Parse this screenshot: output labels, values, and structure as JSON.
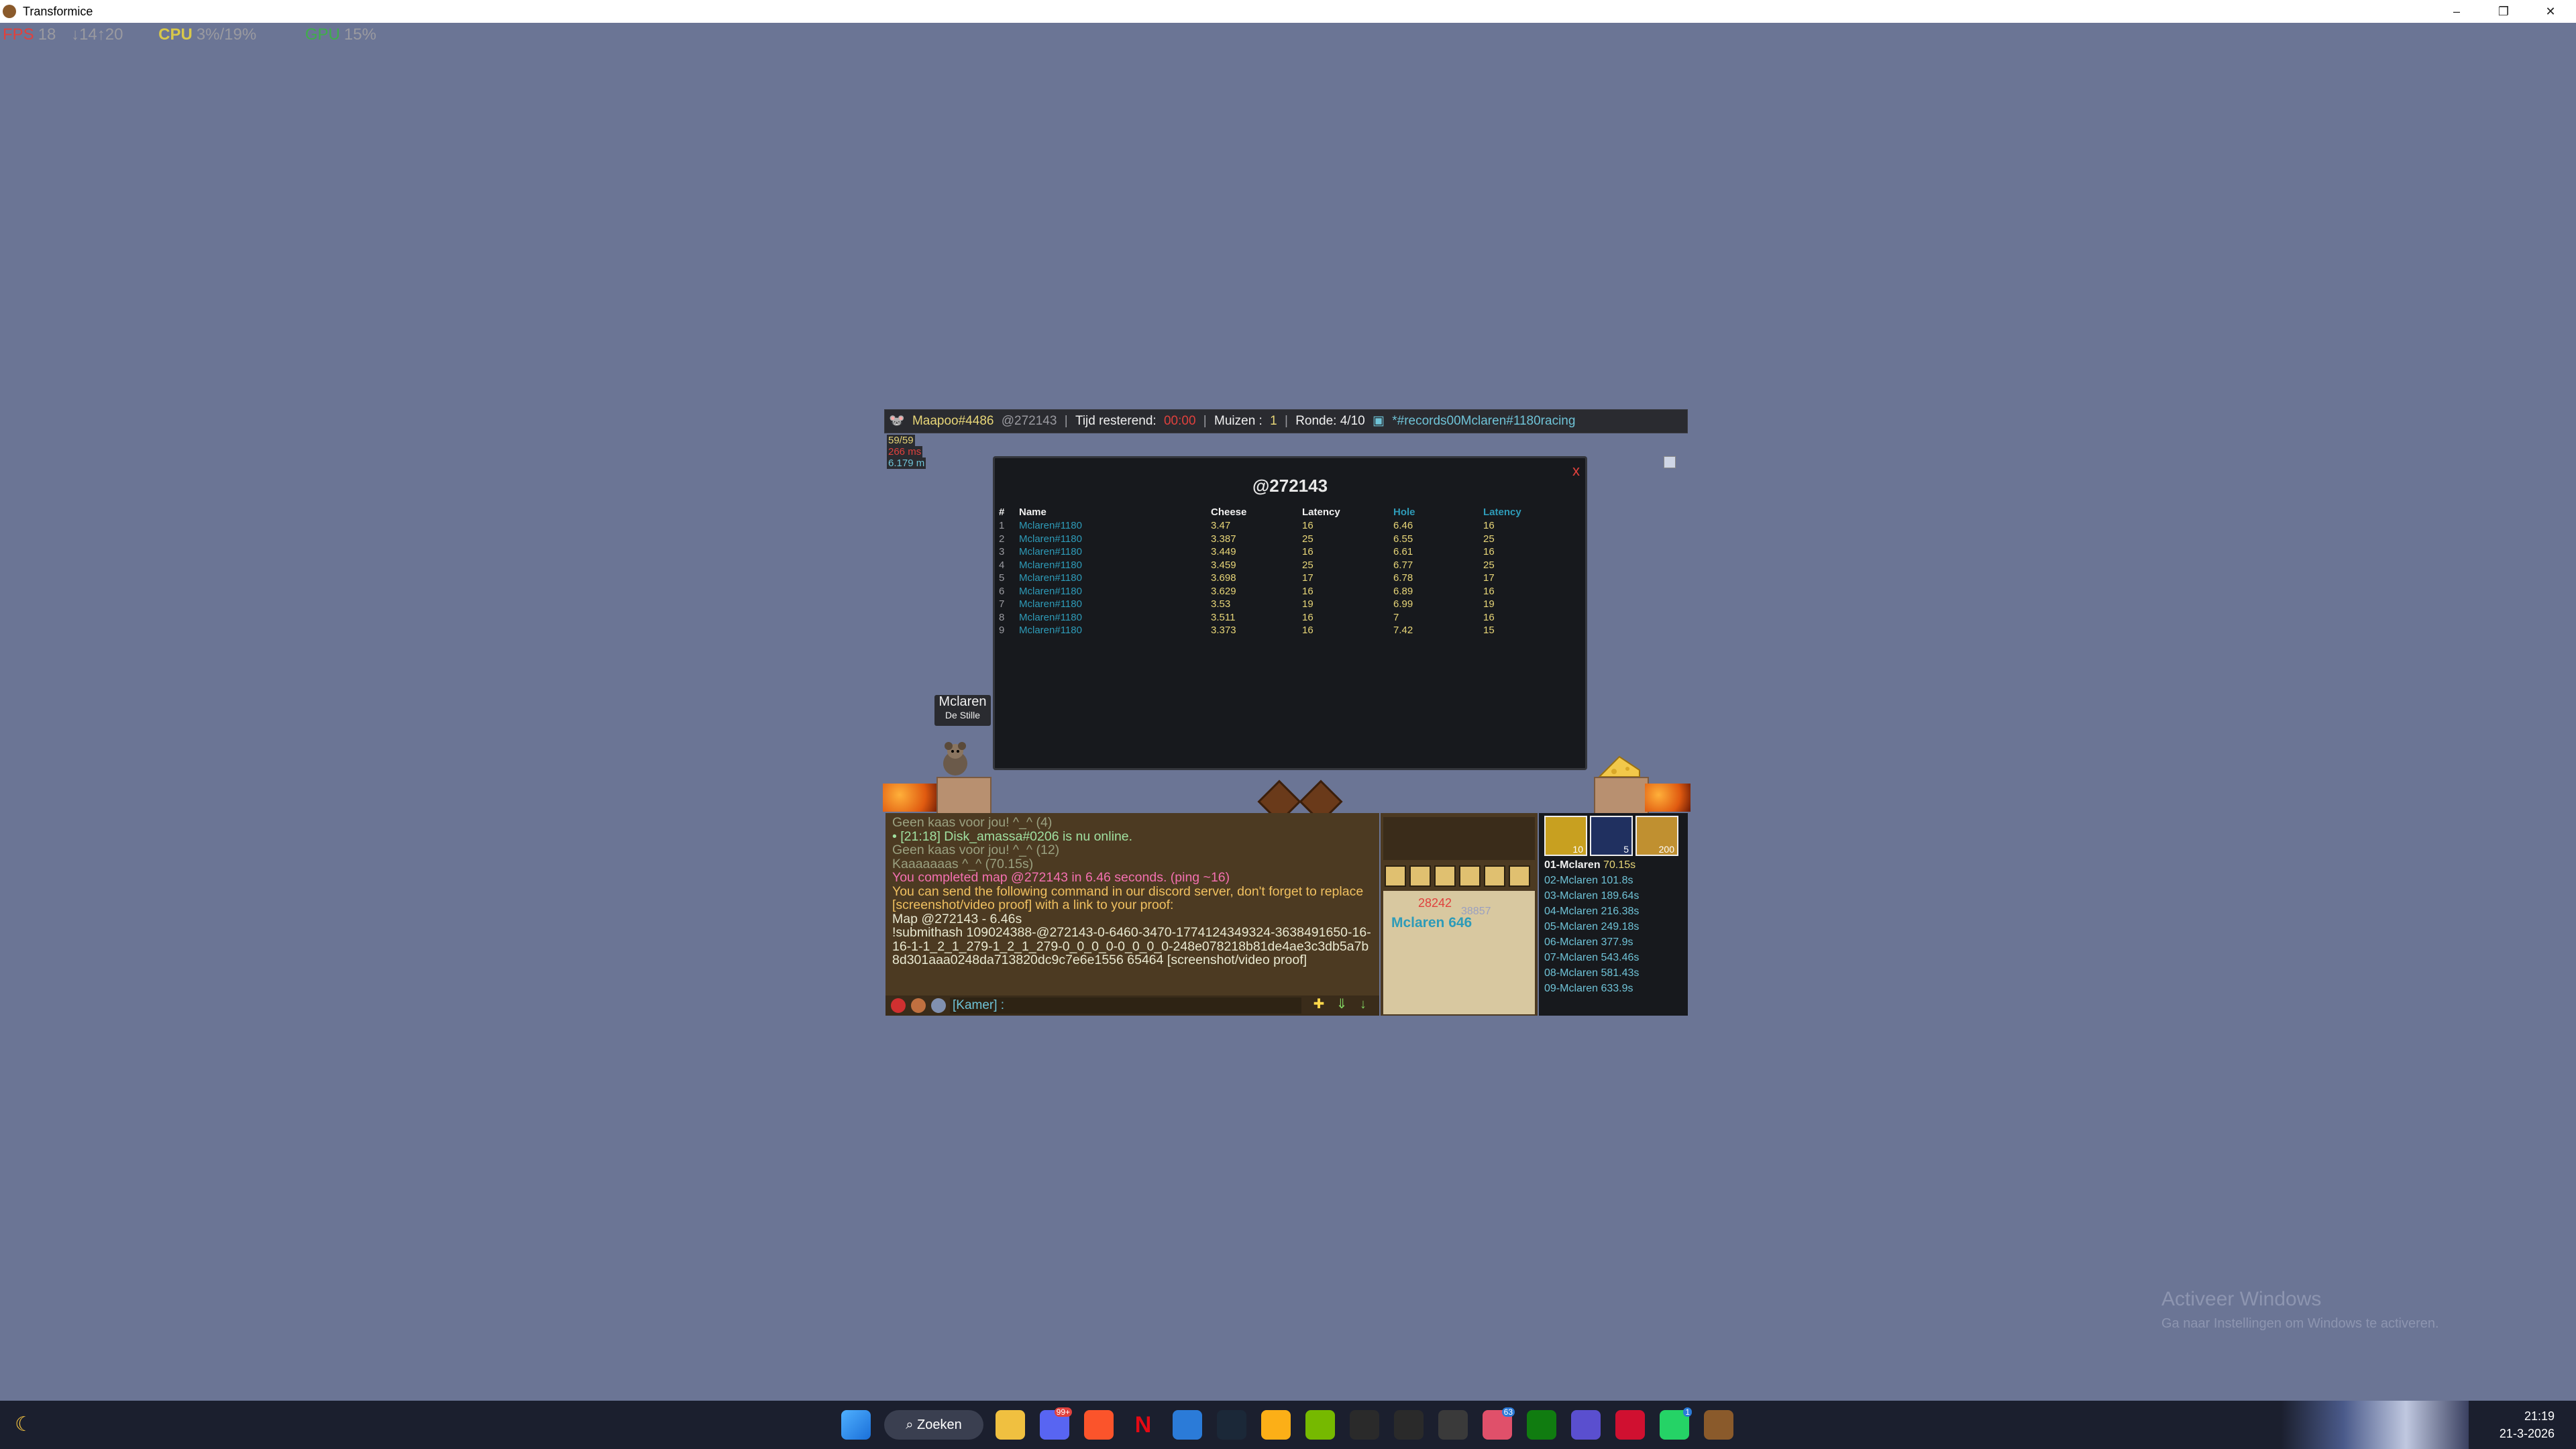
{
  "window": {
    "title": "Transformice",
    "minimize": "–",
    "restore": "❐",
    "close": "✕"
  },
  "perf": {
    "fps_label": "FPS",
    "fps_value": "18",
    "net": "↓14↑20",
    "cpu_label": "CPU",
    "cpu_value": "3%/19%",
    "gpu_label": "GPU",
    "gpu_value": "15%"
  },
  "topbar": {
    "map_author": "Maapoo#4486",
    "map_code": "@272143",
    "time_label": "Tijd resterend:",
    "time_value": "00:00",
    "mice_label": "Muizen :",
    "mice_value": "1",
    "round_label": "Ronde: 4/10",
    "room": "*#records00Mclaren#1180racing"
  },
  "ping_overlay": [
    "59/59",
    "266 ms",
    "6.179 m"
  ],
  "records": {
    "title": "@272143",
    "close": "x",
    "headers": {
      "num": "#",
      "name": "Name",
      "cheese": "Cheese",
      "cheese_latency": "Latency",
      "hole": "Hole",
      "hole_latency": "Latency"
    },
    "rows": [
      {
        "num": "1",
        "name": "Mclaren#1180",
        "cheese": "3.47",
        "cl": "16",
        "hole": "6.46",
        "hl": "16"
      },
      {
        "num": "2",
        "name": "Mclaren#1180",
        "cheese": "3.387",
        "cl": "25",
        "hole": "6.55",
        "hl": "25"
      },
      {
        "num": "3",
        "name": "Mclaren#1180",
        "cheese": "3.449",
        "cl": "16",
        "hole": "6.61",
        "hl": "16"
      },
      {
        "num": "4",
        "name": "Mclaren#1180",
        "cheese": "3.459",
        "cl": "25",
        "hole": "6.77",
        "hl": "25"
      },
      {
        "num": "5",
        "name": "Mclaren#1180",
        "cheese": "3.698",
        "cl": "17",
        "hole": "6.78",
        "hl": "17"
      },
      {
        "num": "6",
        "name": "Mclaren#1180",
        "cheese": "3.629",
        "cl": "16",
        "hole": "6.89",
        "hl": "16"
      },
      {
        "num": "7",
        "name": "Mclaren#1180",
        "cheese": "3.53",
        "cl": "19",
        "hole": "6.99",
        "hl": "19"
      },
      {
        "num": "8",
        "name": "Mclaren#1180",
        "cheese": "3.511",
        "cl": "16",
        "hole": "7",
        "hl": "16"
      },
      {
        "num": "9",
        "name": "Mclaren#1180",
        "cheese": "3.373",
        "cl": "16",
        "hole": "7.42",
        "hl": "15"
      }
    ]
  },
  "player": {
    "name": "Mclaren",
    "title": "De Stille"
  },
  "chat": {
    "lines": [
      {
        "text": "Geen kaas voor jou! ^_^ (4)",
        "style": "muted"
      },
      {
        "text": "• [21:18] Disk_amassa#0206 is nu online.",
        "style": "green"
      },
      {
        "text": "Geen kaas voor jou! ^_^ (12)",
        "style": "muted"
      },
      {
        "text": "Kaaaaaaas ^_^ (70.15s)",
        "style": "muted"
      },
      {
        "text": "You completed map @272143 in 6.46 seconds. (ping ~16)",
        "style": "pink"
      },
      {
        "text": "You can send the following command in our discord server, don't forget to replace [screenshot/video proof] with a link to your proof:",
        "style": "orange"
      },
      {
        "text": "Map @272143 - 6.46s",
        "style": "plain"
      },
      {
        "text": "!submithash 109024388-@272143-0-6460-3470-1774124349324-3638491650-16-16-1-1_2_1_279-1_2_1_279-0_0_0_0-0_0_0_0-248e078218b81de4ae3c3db5a7b8d301aaa0248da713820dc9c7e6e1556 65464 [screenshot/video proof]",
        "style": "plain"
      }
    ],
    "input_placeholder": "[Kamer] :"
  },
  "profile": {
    "cheese": "28242",
    "firsts": "38857",
    "name_level": "Mclaren 646"
  },
  "times": {
    "powers": [
      "10",
      "5",
      "200"
    ],
    "entries": [
      {
        "label": "01-Mclaren",
        "time": "70.15s"
      },
      {
        "label": "02-Mclaren",
        "time": "101.8s"
      },
      {
        "label": "03-Mclaren",
        "time": "189.64s"
      },
      {
        "label": "04-Mclaren",
        "time": "216.38s"
      },
      {
        "label": "05-Mclaren",
        "time": "249.18s"
      },
      {
        "label": "06-Mclaren",
        "time": "377.9s"
      },
      {
        "label": "07-Mclaren",
        "time": "543.46s"
      },
      {
        "label": "08-Mclaren",
        "time": "581.43s"
      },
      {
        "label": "09-Mclaren",
        "time": "633.9s"
      }
    ]
  },
  "activation": {
    "title": "Activeer Windows",
    "subtitle": "Ga naar Instellingen om Windows te activeren."
  },
  "taskbar": {
    "search": "Zoeken",
    "time": "21:19",
    "date": "21-3-2026",
    "badge_discord": "99+",
    "badge_mail": "63",
    "badge_whatsapp": "1"
  }
}
